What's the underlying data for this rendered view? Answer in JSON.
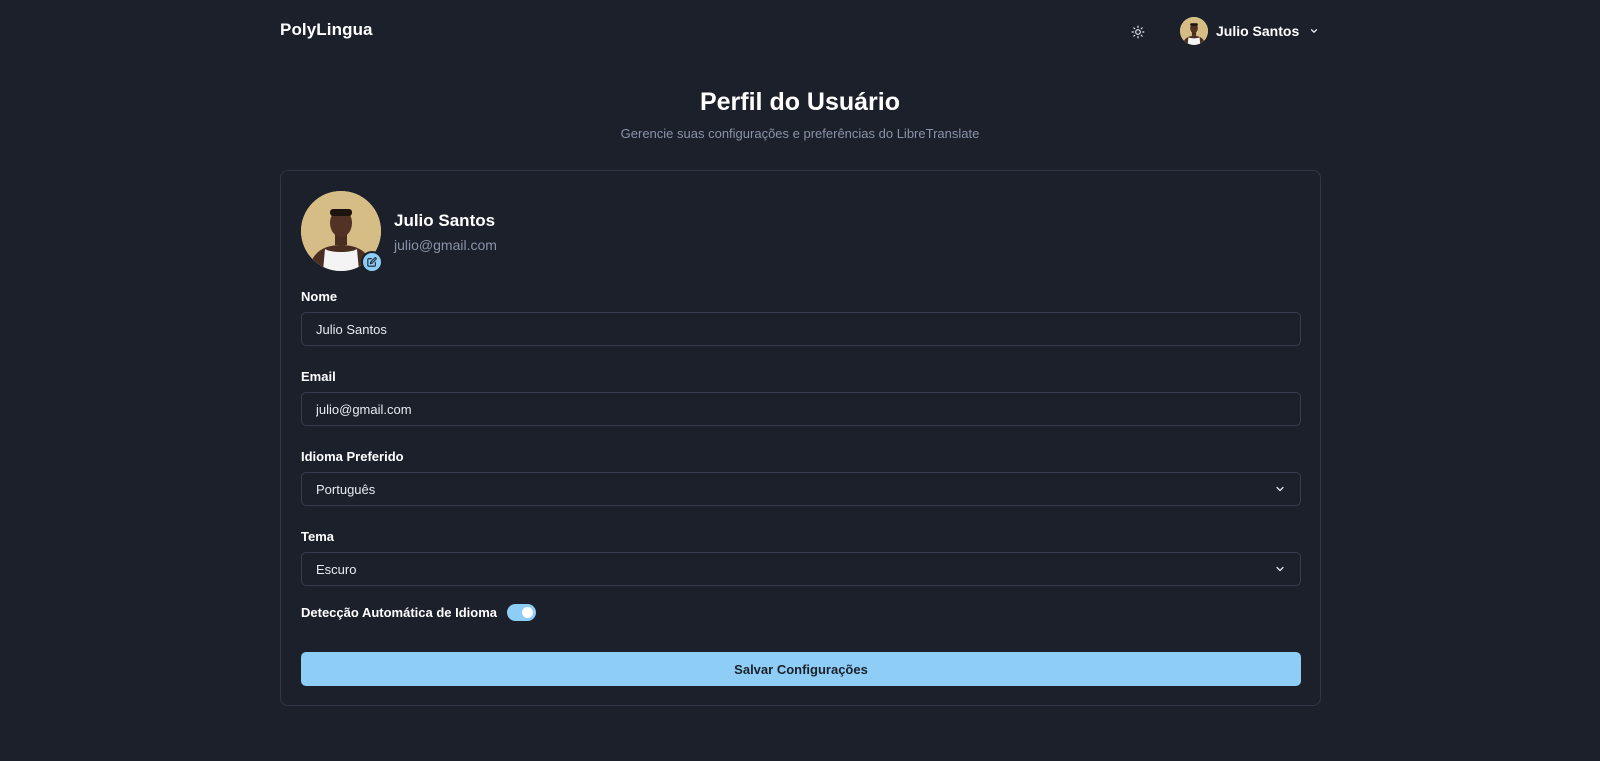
{
  "app": {
    "brand": "PolyLingua"
  },
  "header": {
    "theme_icon": "sun-icon",
    "user_name": "Julio Santos",
    "user_menu_icon": "chevron-down-icon"
  },
  "page": {
    "title": "Perfil do Usuário",
    "subtitle": "Gerencie suas configurações e preferências do LibreTranslate"
  },
  "profile": {
    "name": "Julio Santos",
    "email": "julio@gmail.com",
    "avatar_edit_icon": "edit-icon"
  },
  "form": {
    "name_label": "Nome",
    "name_value": "Julio Santos",
    "email_label": "Email",
    "email_value": "julio@gmail.com",
    "language_label": "Idioma Preferido",
    "language_value": "Português",
    "theme_label": "Tema",
    "theme_value": "Escuro",
    "auto_detect_label": "Detecção Automática de Idioma",
    "auto_detect_enabled": true,
    "save_label": "Salvar Configurações"
  },
  "colors": {
    "background": "#1b202b",
    "accent": "#8ecdf5",
    "border": "#363d4e",
    "muted_text": "#8a93a6"
  }
}
